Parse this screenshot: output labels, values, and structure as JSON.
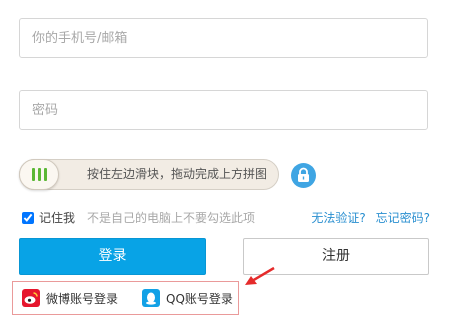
{
  "login_form": {
    "phone_placeholder": "你的手机号/邮箱",
    "password_placeholder": "密码"
  },
  "slider": {
    "text": "按住左边滑块，拖动完成上方拼图",
    "icon": "lock-icon"
  },
  "remember": {
    "label": "记住我",
    "checked": true,
    "hint": "不是自己的电脑上不要勾选此项"
  },
  "links": {
    "cant_verify": "无法验证?",
    "forgot_password": "忘记密码?"
  },
  "buttons": {
    "login": "登录",
    "register": "注册"
  },
  "social": [
    {
      "label": "微博账号登录",
      "icon": "weibo-icon"
    },
    {
      "label": "QQ账号登录",
      "icon": "qq-icon"
    }
  ],
  "colors": {
    "primary": "#08a3e6",
    "link": "#2a8fd0",
    "handle_accent": "#5bb734",
    "annotation": "#e52b2b"
  }
}
